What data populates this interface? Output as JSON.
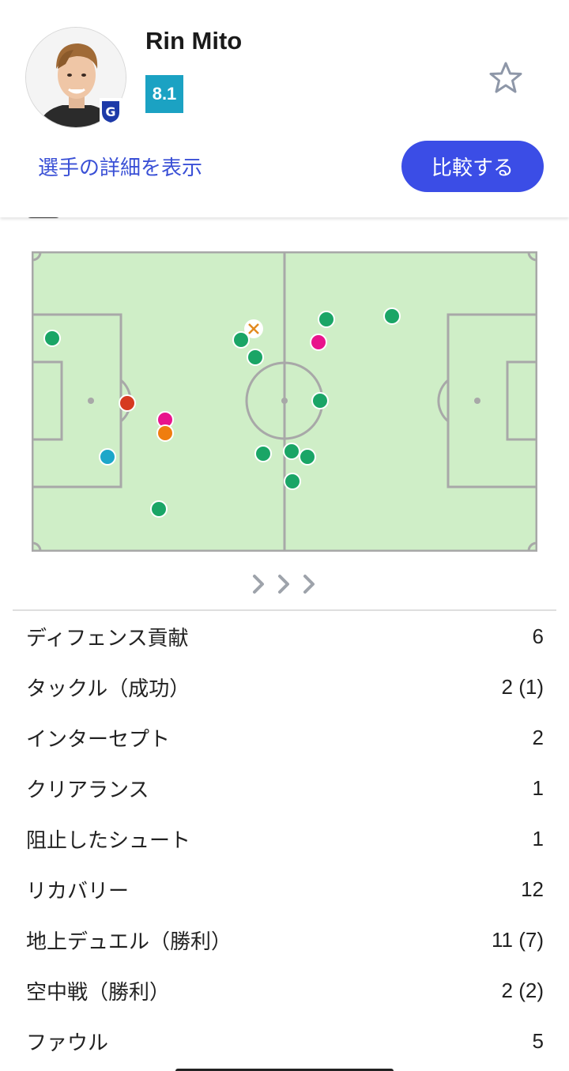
{
  "player": {
    "name": "Rin Mito",
    "rating": "8.1"
  },
  "actions": {
    "details_link": "選手の詳細を表示",
    "compare_button": "比較する"
  },
  "colors": {
    "accent": "#3b4de6",
    "rating_bg": "#1ba2c3",
    "pitch": "#cfeec7",
    "pitch_lines": "#a8a8a8"
  },
  "heatmap": {
    "legend_colors": {
      "green": "#1aa566",
      "pink": "#e8148c",
      "red": "#d63a20",
      "orange": "#ef7d0f",
      "cyan": "#1ca7c9",
      "cross": "#e28a1f"
    }
  },
  "stats": [
    {
      "label": "ディフェンス貢献",
      "value": "6"
    },
    {
      "label": "タックル（成功）",
      "value": "2 (1)"
    },
    {
      "label": "インターセプト",
      "value": "2"
    },
    {
      "label": "クリアランス",
      "value": "1"
    },
    {
      "label": "阻止したシュート",
      "value": "1"
    },
    {
      "label": "リカバリー",
      "value": "12"
    },
    {
      "label": "地上デュエル（勝利）",
      "value": "11 (7)"
    },
    {
      "label": "空中戦（勝利）",
      "value": "2 (2)"
    },
    {
      "label": "ファウル",
      "value": "5"
    }
  ]
}
